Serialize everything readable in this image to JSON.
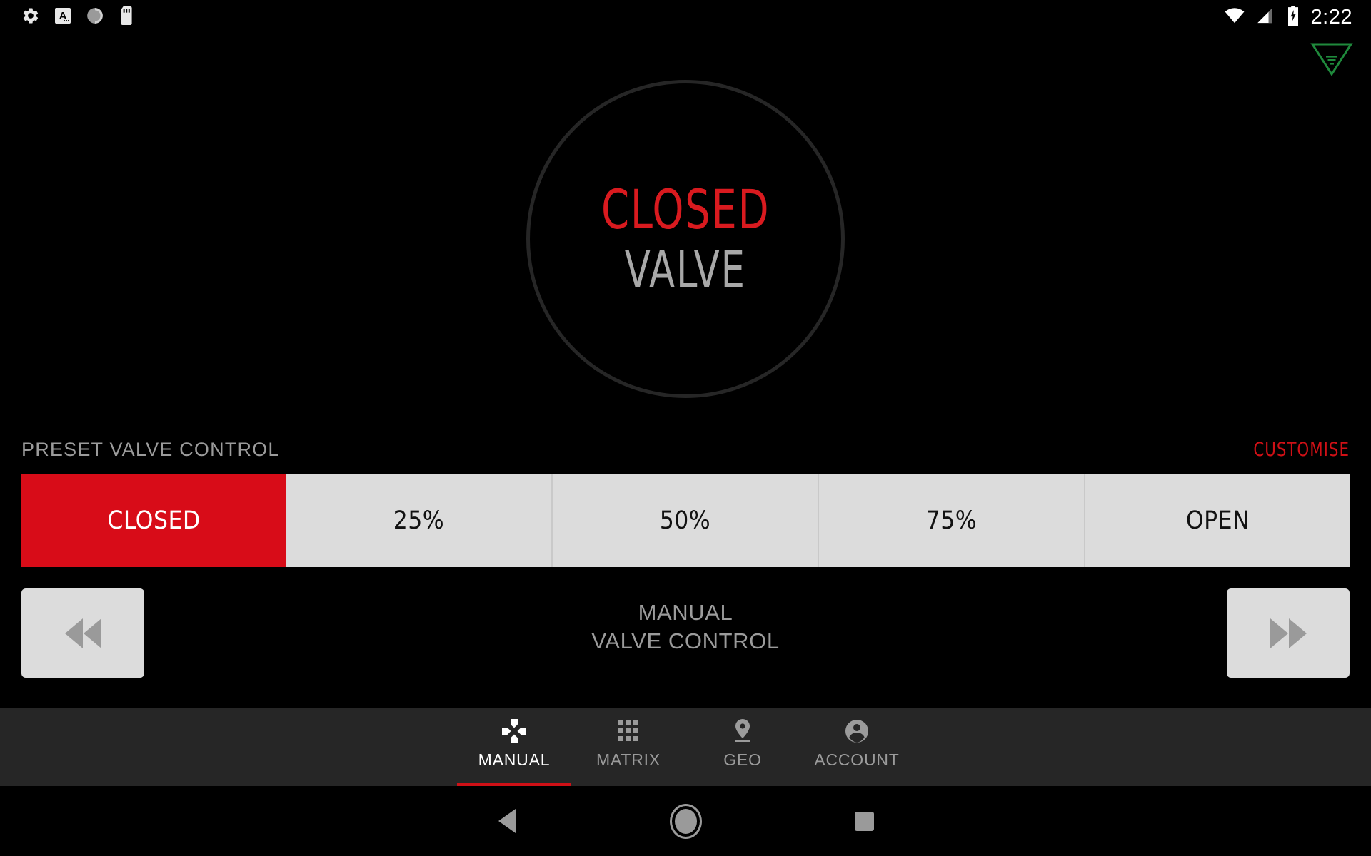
{
  "status_bar": {
    "time": "2:22",
    "left_icons": [
      "gear-icon",
      "a-badge-icon",
      "sync-spinner-icon",
      "sd-card-icon"
    ],
    "right_icons": [
      "wifi-icon",
      "cellular-signal-icon",
      "battery-charging-icon"
    ]
  },
  "brand": {
    "logo_name": "v-brand-logo",
    "color": "#1f8a3c"
  },
  "valve": {
    "state": "CLOSED",
    "subtitle": "VALVE",
    "state_color": "#d91a1f",
    "subtitle_color": "#a8a8a8",
    "ring_color": "#262626"
  },
  "preset_section": {
    "title": "PRESET VALVE CONTROL",
    "customise_label": "CUSTOMISE",
    "customise_color": "#cf1016",
    "active_index": 0,
    "buttons": [
      {
        "label": "CLOSED",
        "active": true
      },
      {
        "label": "25%",
        "active": false
      },
      {
        "label": "50%",
        "active": false
      },
      {
        "label": "75%",
        "active": false
      },
      {
        "label": "OPEN",
        "active": false
      }
    ],
    "active_bg": "#d80c18",
    "inactive_bg": "#dcdcdc"
  },
  "manual_section": {
    "line1": "MANUAL",
    "line2": "VALVE CONTROL",
    "back_button_name": "rewind-icon",
    "forward_button_name": "fast-forward-icon"
  },
  "tabs": [
    {
      "label": "MANUAL",
      "icon": "dpad-icon",
      "active": true
    },
    {
      "label": "MATRIX",
      "icon": "grid-icon",
      "active": false
    },
    {
      "label": "GEO",
      "icon": "map-pin-icon",
      "active": false
    },
    {
      "label": "ACCOUNT",
      "icon": "account-icon",
      "active": false
    }
  ],
  "tab_bar": {
    "background": "#262626",
    "active_color": "#ffffff",
    "indicator_color": "#cf1016",
    "inactive_color": "#9b9b9b"
  },
  "nav_bar": {
    "back": "back-triangle-icon",
    "home": "home-circle-icon",
    "recents": "recents-square-icon"
  }
}
